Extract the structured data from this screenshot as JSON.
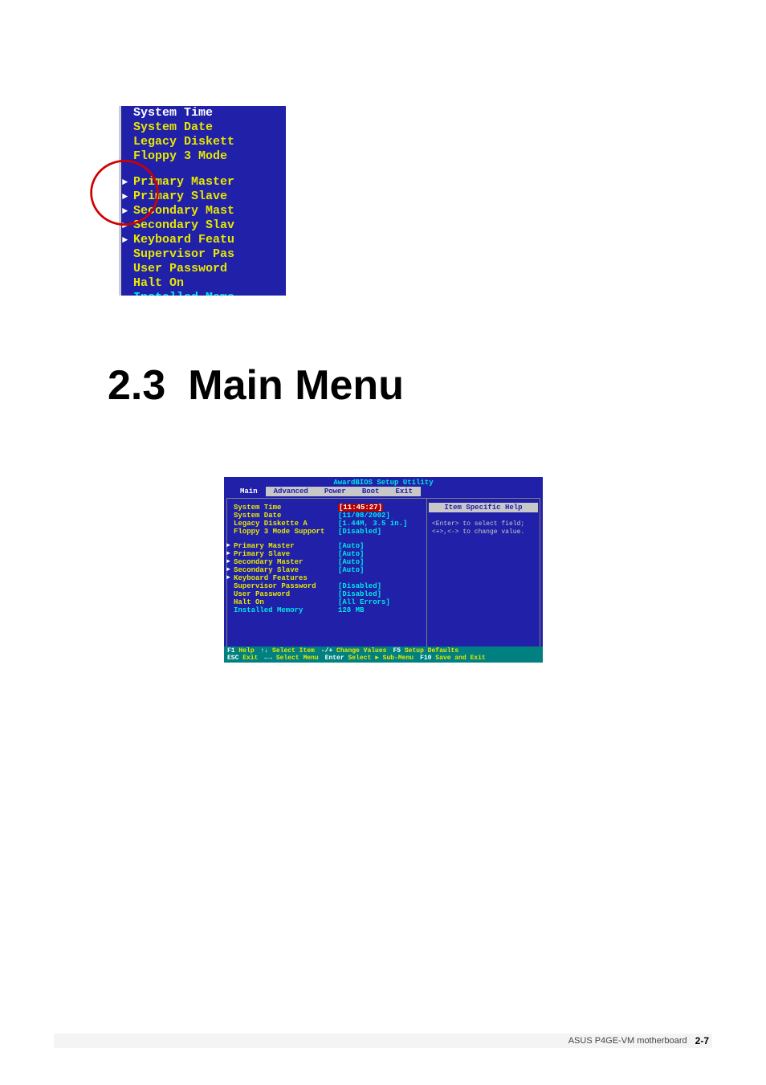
{
  "heading": {
    "number": "2.3",
    "title": "Main Menu"
  },
  "top_snippet": {
    "lines": [
      {
        "text": "System Time",
        "cls": "white"
      },
      {
        "text": "System Date",
        "cls": ""
      },
      {
        "text": "Legacy Diskett",
        "cls": ""
      },
      {
        "text": "Floppy 3 Mode",
        "cls": ""
      }
    ],
    "sublines": [
      {
        "text": "Primary Master",
        "sub": true
      },
      {
        "text": "Primary Slave",
        "sub": true
      },
      {
        "text": "Secondary Mast",
        "sub": true
      },
      {
        "text": "Secondary Slav",
        "sub": true
      },
      {
        "text": "Keyboard Featu",
        "sub": true
      },
      {
        "text": "Supervisor Pas",
        "sub": false
      },
      {
        "text": "User Password",
        "sub": false
      },
      {
        "text": "Halt On",
        "sub": false
      },
      {
        "text": "Installed Memo",
        "sub": false,
        "cls": "cyan"
      }
    ]
  },
  "bios": {
    "title": "AwardBIOS Setup Utility",
    "tabs": [
      "Main",
      "Advanced",
      "Power",
      "Boot",
      "Exit"
    ],
    "active_tab": "Main",
    "help_title": "Item Specific Help",
    "help_lines": [
      "<Enter> to select field;",
      "<+>,<-> to change value."
    ],
    "rows_top": [
      {
        "label": "System Time",
        "value": "[11:45:27]",
        "hl": true
      },
      {
        "label": "System Date",
        "value": "[11/08/2002]"
      },
      {
        "label": "Legacy Diskette A",
        "value": "[1.44M, 3.5 in.]"
      },
      {
        "label": "Floppy 3 Mode Support",
        "value": "[Disabled]"
      }
    ],
    "rows_sub": [
      {
        "label": "Primary Master",
        "value": "[Auto]",
        "sub": true
      },
      {
        "label": "Primary Slave",
        "value": "[Auto]",
        "sub": true
      },
      {
        "label": "Secondary Master",
        "value": "[Auto]",
        "sub": true
      },
      {
        "label": "Secondary Slave",
        "value": "[Auto]",
        "sub": true
      },
      {
        "label": "Keyboard Features",
        "value": "",
        "sub": true
      },
      {
        "label": "Supervisor Password",
        "value": "[Disabled]"
      },
      {
        "label": "User Password",
        "value": "[Disabled]"
      },
      {
        "label": "Halt On",
        "value": "[All Errors]"
      },
      {
        "label": "Installed Memory",
        "value": "128 MB",
        "cls": "cyan"
      }
    ],
    "footer": [
      [
        {
          "k": "F1",
          "v": "Help"
        },
        {
          "k": "↑↓",
          "v": "Select Item"
        },
        {
          "k": "-/+",
          "v": "Change Values"
        },
        {
          "k": "F5",
          "v": "Setup Defaults"
        }
      ],
      [
        {
          "k": "ESC",
          "v": "Exit"
        },
        {
          "k": "←→",
          "v": "Select Menu"
        },
        {
          "k": "Enter",
          "v": "Select ► Sub-Menu"
        },
        {
          "k": "F10",
          "v": "Save and Exit"
        }
      ]
    ]
  },
  "page_footer": {
    "text": "ASUS P4GE-VM motherboard",
    "num": "2-7"
  }
}
